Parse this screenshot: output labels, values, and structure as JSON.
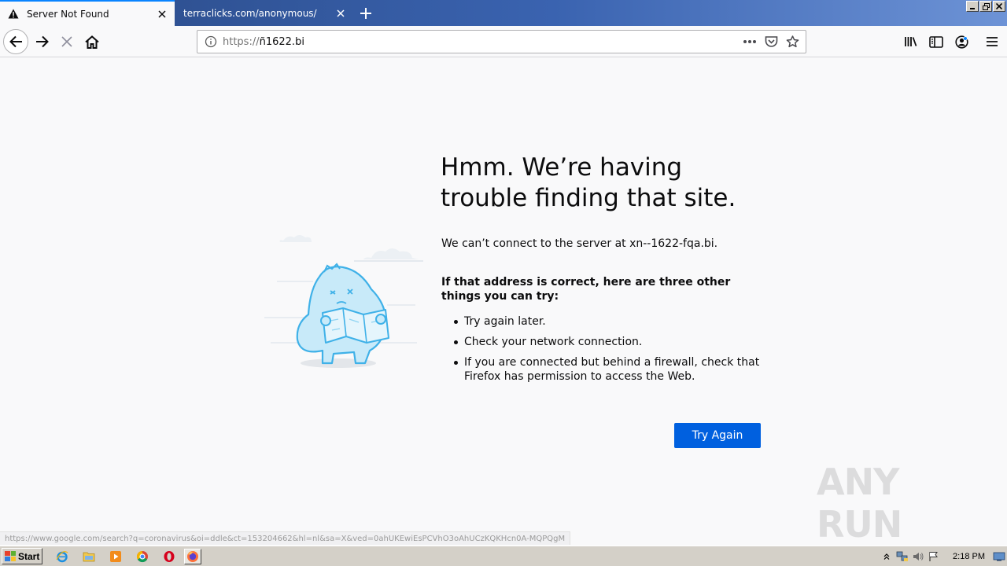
{
  "browser": {
    "tabs": [
      {
        "title": "Server Not Found",
        "active": true
      },
      {
        "title": "terraclicks.com/anonymous/",
        "active": false
      }
    ],
    "url": {
      "protocol": "https://",
      "host": "ñ1622.bi"
    },
    "accent_color": "#0a84ff"
  },
  "error": {
    "title": "Hmm. We’re having trouble finding that site.",
    "description": "We can’t connect to the server at xn--1622-fqa.bi.",
    "subtitle": "If that address is correct, here are three other things you can try:",
    "suggestions": [
      "Try again later.",
      "Check your network connection.",
      "If you are connected but behind a firewall, check that Firefox has permission to access the Web."
    ],
    "try_again_label": "Try Again",
    "button_color": "#0060df"
  },
  "status_bar": {
    "hover_url": "https://www.google.com/search?q=coronavirus&oi=ddle&ct=153204662&hl=nl&sa=X&ved=0ahUKEwiEsPCVhO3oAhUCzKQKHcn0A-MQPQgM"
  },
  "watermark": {
    "text": "ANY RUN"
  },
  "taskbar": {
    "start_label": "Start",
    "clock": "2:18 PM",
    "quick_launch": [
      "ie-icon",
      "explorer-icon",
      "media-player-icon",
      "chrome-icon",
      "opera-icon",
      "firefox-icon"
    ]
  }
}
